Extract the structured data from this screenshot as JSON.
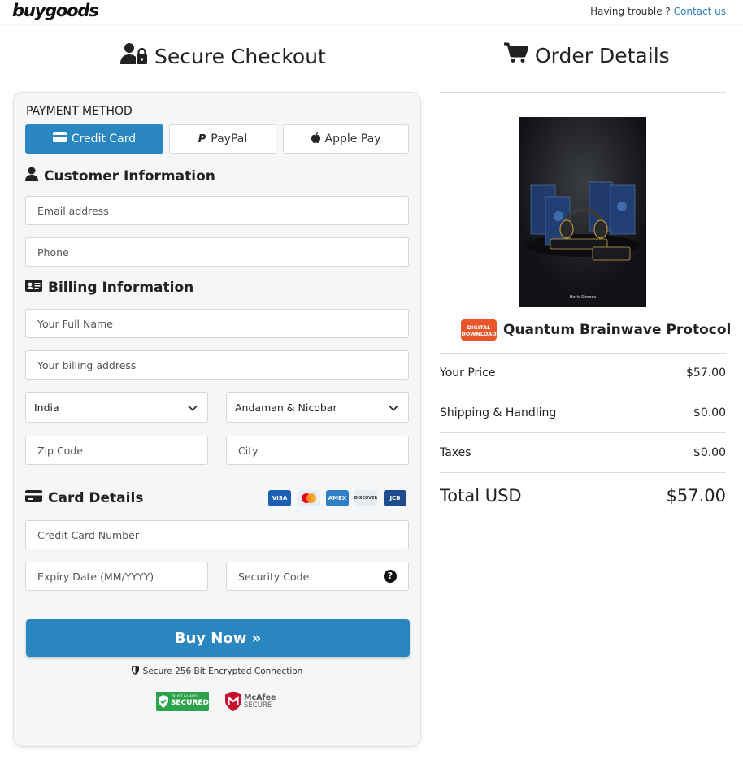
{
  "header": {
    "logo": "buygoods",
    "help_text": "Having trouble ?",
    "contact_link": "Contact us"
  },
  "checkout": {
    "title": "Secure Checkout",
    "payment_method_label": "PAYMENT METHOD",
    "tabs": [
      {
        "label": "Credit Card",
        "active": true
      },
      {
        "label": "PayPal",
        "active": false
      },
      {
        "label": "Apple Pay",
        "active": false
      }
    ],
    "customer_info": {
      "heading": "Customer Information",
      "email_placeholder": "Email address",
      "phone_placeholder": "Phone"
    },
    "billing_info": {
      "heading": "Billing Information",
      "full_name_placeholder": "Your Full Name",
      "address_placeholder": "Your billing address",
      "country_value": "India",
      "state_value": "Andaman & Nicobar",
      "zip_placeholder": "Zip Code",
      "city_placeholder": "City"
    },
    "card_details": {
      "heading": "Card Details",
      "card_logos": [
        "VISA",
        "mastercard",
        "AMEX",
        "DISCOVER",
        "JCB"
      ],
      "card_number_placeholder": "Credit Card Number",
      "expiry_placeholder": "Expiry Date (MM/YYYY)",
      "security_code_placeholder": "Security Code"
    },
    "buy_button": "Buy Now »",
    "secure_note": "Secure 256 Bit Encrypted Connection",
    "badges": {
      "trust_guard": {
        "line1": "TRUST GUARD",
        "line2": "SECURED"
      },
      "mcafee": {
        "line1": "McAfee",
        "line2": "SECURE"
      }
    },
    "accent_color": "#2a86bf"
  },
  "order": {
    "title": "Order Details",
    "product_badge_line1": "DIGITAL",
    "product_badge_line2": "DOWNLOAD",
    "product_name": "Quantum Brainwave Protocol",
    "product_image_caption": "Heric Simons",
    "your_price_label": "Your Price",
    "your_price_value": "$57.00",
    "shipping_label": "Shipping & Handling",
    "shipping_value": "$0.00",
    "taxes_label": "Taxes",
    "taxes_value": "$0.00",
    "total_label": "Total USD",
    "total_value": "$57.00"
  }
}
